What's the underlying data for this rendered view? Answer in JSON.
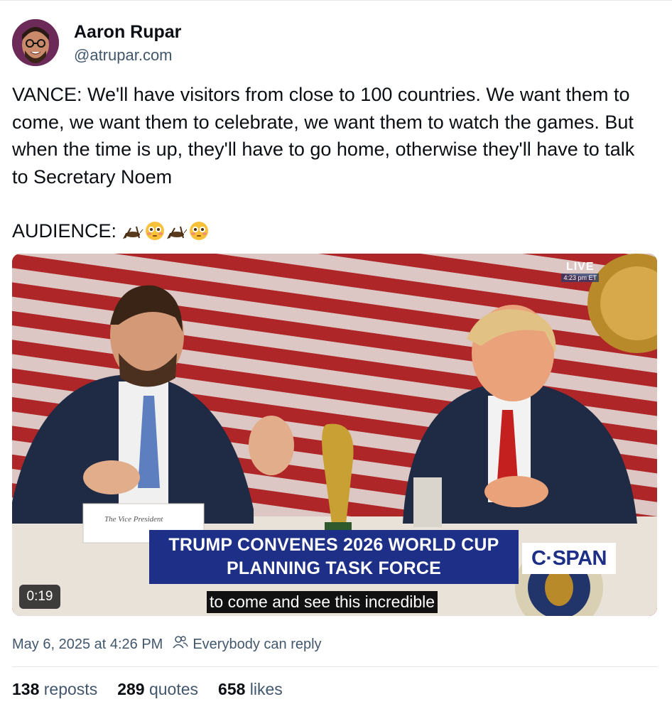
{
  "author": {
    "name": "Aaron Rupar",
    "handle": "@atrupar.com"
  },
  "post": {
    "text": "VANCE: We'll have visitors from close to 100 countries. We want them to come, we want them to celebrate, we want them to watch the games. But when the time is up, they'll have to go home, otherwise they'll have to talk to Secretary Noem",
    "audience_label": "AUDIENCE:",
    "audience_emoji": [
      "cricket-icon",
      "flushed-face-icon",
      "cricket-icon",
      "flushed-face-icon"
    ]
  },
  "video": {
    "live_label": "LIVE",
    "live_time": "4:23 pm ET",
    "nameplate": "The Vice President",
    "chyron_line1": "TRUMP CONVENES 2026 WORLD CUP",
    "chyron_line2": "PLANNING TASK FORCE",
    "network": "C·SPAN",
    "caption": "to come and see this incredible",
    "duration": "0:19"
  },
  "meta": {
    "timestamp": "May 6, 2025 at 4:26 PM",
    "reply_setting": "Everybody can reply"
  },
  "stats": {
    "reposts_count": "138",
    "reposts_label": "reposts",
    "quotes_count": "289",
    "quotes_label": "quotes",
    "likes_count": "658",
    "likes_label": "likes"
  },
  "colors": {
    "text": "#0b0f14",
    "muted": "#42576c",
    "chyron": "#1d2f86"
  }
}
